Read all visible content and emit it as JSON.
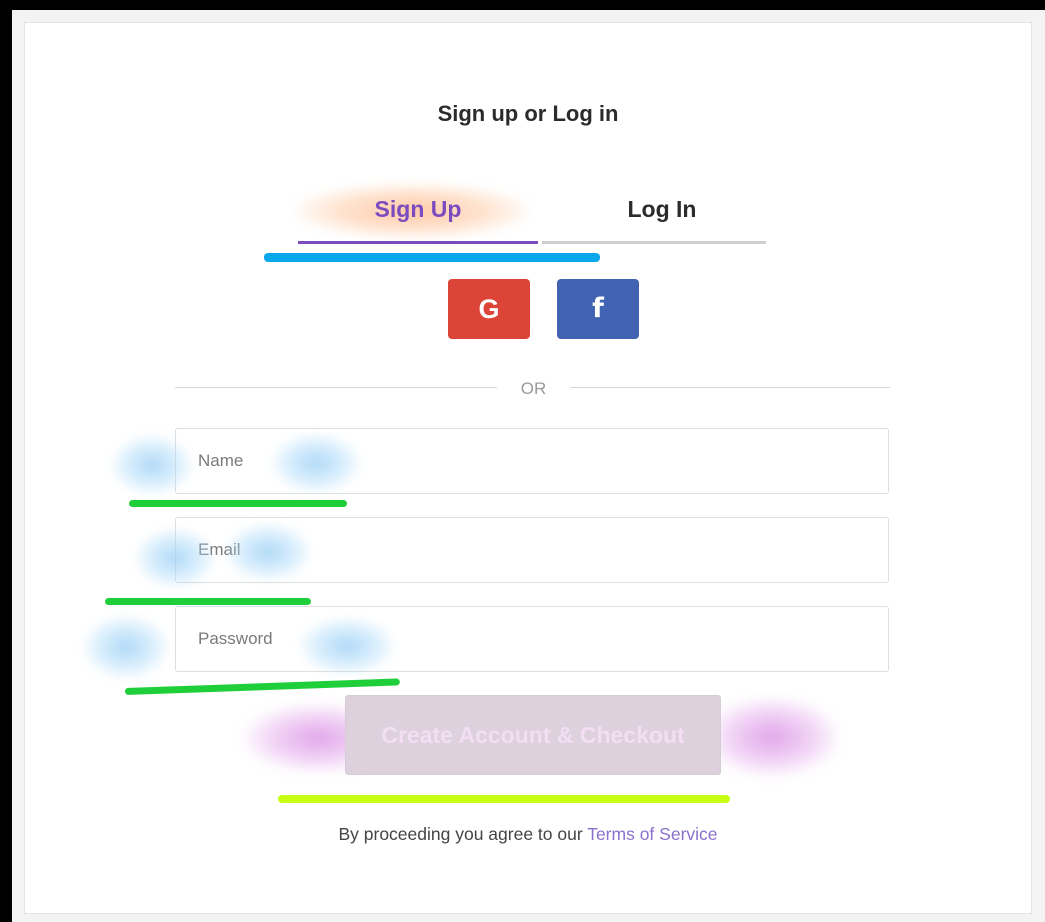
{
  "form": {
    "title": "Sign up or Log in",
    "tabs": [
      {
        "label": "Sign Up",
        "active": true
      },
      {
        "label": "Log In",
        "active": false
      }
    ],
    "social": {
      "google_label": "G",
      "google_color": "#dc4437",
      "facebook_label": "f",
      "facebook_color": "#4262b2"
    },
    "divider_text": "OR",
    "fields": {
      "name_placeholder": "Name",
      "email_placeholder": "Email",
      "password_placeholder": "Password"
    },
    "submit_label": "Create Account & Checkout",
    "legal_prefix": "By proceeding you agree to our ",
    "legal_link": "Terms of Service"
  },
  "colors": {
    "accent": "#7b4cbf",
    "link": "#8b71cc"
  }
}
